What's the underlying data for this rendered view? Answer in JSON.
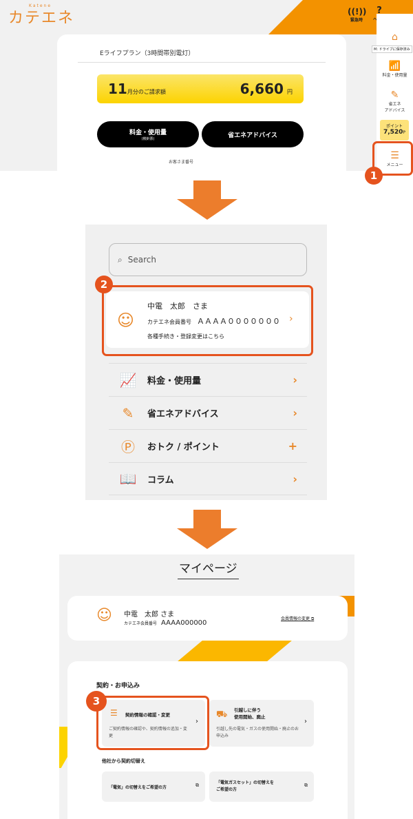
{
  "step1": {
    "logo": "カテエネ",
    "logo_sub": "Katene",
    "plan": "Eライフプラン（3時間帯別電灯）",
    "bill_month": "11",
    "bill_label": "月分のご請求額",
    "bill_amount": "6,660",
    "bill_unit": "円",
    "btn_usage": "料金・使用量",
    "btn_usage_sub": "(検針票)",
    "btn_advice": "省エネアドバイス",
    "customer_no": "お客さま番号",
    "header": {
      "emergency": "緊急時",
      "help": "ヘルプ"
    },
    "sidebar": {
      "home_tooltip": "M: ドライブに保存済み",
      "usage": "料金・使用量",
      "advice_1": "省エネ",
      "advice_2": "アドバイス",
      "point_label": "ポイント",
      "point_value": "7,520",
      "point_unit": "P",
      "menu": "メニュー"
    },
    "badge": "1"
  },
  "step2": {
    "search_placeholder": "Search",
    "badge": "2",
    "member_name": "中電　太郎　さま",
    "member_label": "カテエネ会員番号",
    "member_no": "ＡＡＡＡ０００００００",
    "member_link": "各種手続き・登録変更はこちら",
    "menu": [
      {
        "label": "料金・使用量",
        "icon": "chart-icon",
        "action": "›"
      },
      {
        "label": "省エネアドバイス",
        "icon": "advice-icon",
        "action": "›"
      },
      {
        "label": "おトク / ポイント",
        "icon": "point-icon",
        "action": "+"
      },
      {
        "label": "コラム",
        "icon": "book-icon",
        "action": "›"
      }
    ]
  },
  "step3": {
    "title": "マイページ",
    "member_name": "中電　太郎 さま",
    "member_label": "カテエネ会員番号",
    "member_no": "AAAA000000",
    "member_change": "会員情報の変更",
    "section": "契約・お申込み",
    "badge": "3",
    "tile1_title": "契約情報の確認・変更",
    "tile1_desc": "ご契約情報の確認や、契約情報の追加・変更",
    "tile2_title_1": "引越しに伴う",
    "tile2_title_2": "使用開始、廃止",
    "tile2_desc": "引越し先の電気・ガスの使用開始・廃止のお申込み",
    "switch_title": "他社から契約切替え",
    "switch1": "「電気」の切替えをご希望の方",
    "switch2_1": "「電気ガスセット」の切替えを",
    "switch2_2": "ご希望の方"
  },
  "colors": {
    "accent": "#e8882a",
    "highlight": "#e5531e",
    "yellow": "#fcd300"
  }
}
